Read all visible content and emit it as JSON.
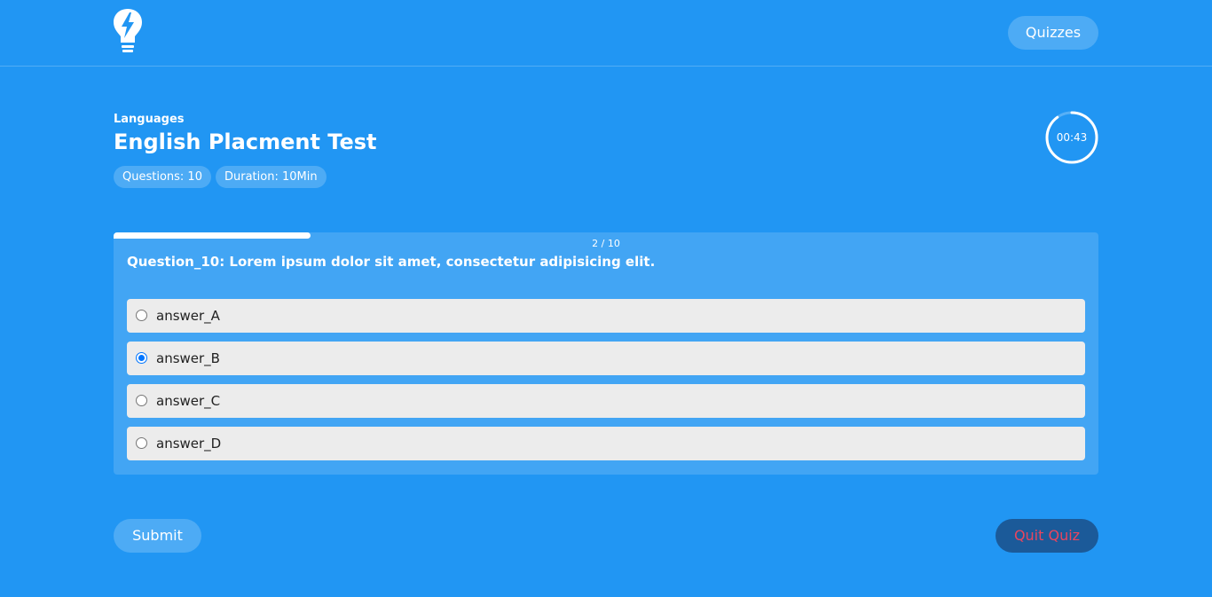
{
  "header": {
    "logo_icon": "lightbulb-bolt-icon",
    "nav_button_label": "Quizzes"
  },
  "quiz": {
    "category": "Languages",
    "title": "English Placment Test",
    "questions_badge": "Questions: 10",
    "duration_badge": "Duration: 10Min",
    "timer": "00:43",
    "timer_fraction_remaining": 0.9
  },
  "progress": {
    "label": "2 / 10",
    "fraction": 0.2
  },
  "question": {
    "text": "Question_10: Lorem ipsum dolor sit amet, consectetur adipisicing elit.",
    "answers": [
      {
        "label": "answer_A",
        "selected": false
      },
      {
        "label": "answer_B",
        "selected": true
      },
      {
        "label": "answer_C",
        "selected": false
      },
      {
        "label": "answer_D",
        "selected": false
      }
    ]
  },
  "actions": {
    "submit_label": "Submit",
    "quit_label": "Quit Quiz"
  },
  "colors": {
    "background": "#2196f3",
    "quit_bg": "#1b5a99",
    "quit_text": "#e9455e",
    "radio_accent": "#0075ff"
  }
}
